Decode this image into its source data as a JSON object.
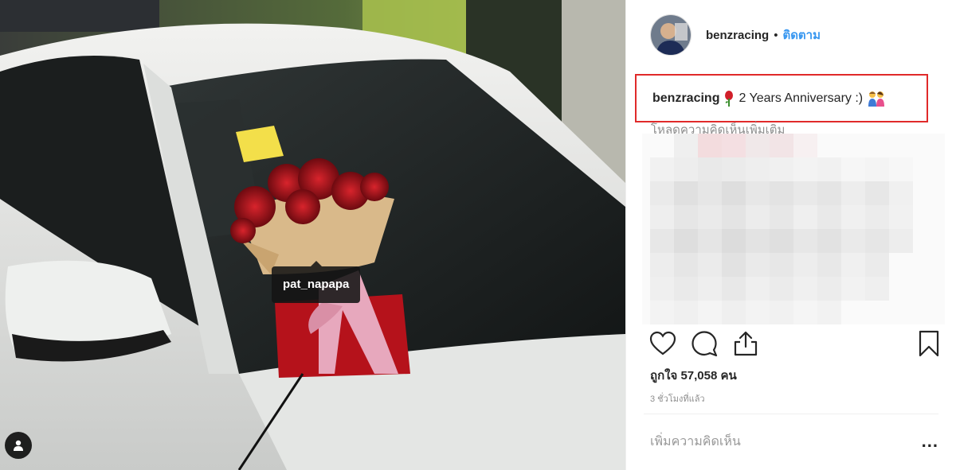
{
  "header": {
    "username": "benzracing",
    "separator": "•",
    "follow_label": "ติดตาม"
  },
  "caption": {
    "username": "benzracing",
    "text": "2 Years Anniversary :)",
    "rose_icon": "rose-icon",
    "couple_icon": "couple-emoji-icon"
  },
  "load_more_comments": "โหลดความคิดเห็นเพิ่มเติม",
  "photo": {
    "tag_username": "pat_napapa",
    "tag_button_icon": "user-tag-icon"
  },
  "actions": {
    "like_icon": "heart-icon",
    "comment_icon": "comment-icon",
    "share_icon": "share-icon",
    "save_icon": "bookmark-icon"
  },
  "likes_text": "ถูกใจ 57,058 คน",
  "timestamp": "3 ชั่วโมงที่แล้ว",
  "comment_input": {
    "placeholder": "เพิ่มความคิดเห็น",
    "more_label": "..."
  },
  "colors": {
    "highlight_box": "#e02a2a",
    "follow_link": "#3897f0",
    "muted_text": "#8e8e8e"
  }
}
